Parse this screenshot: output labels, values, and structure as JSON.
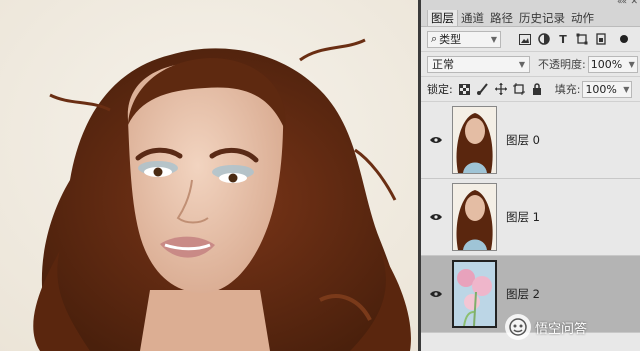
{
  "canvas": {
    "description_icon": "portrait-photo"
  },
  "panel": {
    "collapse_glyph": "««",
    "menu_glyph": "✕",
    "tabs": [
      {
        "label": "图层",
        "active": true
      },
      {
        "label": "通道",
        "active": false
      },
      {
        "label": "路径",
        "active": false
      },
      {
        "label": "历史记录",
        "active": false
      },
      {
        "label": "动作",
        "active": false
      }
    ],
    "filter": {
      "search_glyph": "⌕",
      "value": "类型"
    },
    "filter_icons": [
      "image-filter-icon",
      "adjustment-filter-icon",
      "text-filter-icon",
      "shape-filter-icon",
      "smart-object-filter-icon"
    ],
    "blend_mode": "正常",
    "opacity_label": "不透明度:",
    "opacity_value": "100%",
    "lock_label": "锁定:",
    "lock_icons": [
      "lock-transparent-icon",
      "lock-image-icon",
      "lock-position-icon",
      "lock-artboard-icon",
      "lock-all-icon"
    ],
    "fill_label": "填充:",
    "fill_value": "100%",
    "layers": [
      {
        "name": "图层 0",
        "selected": false,
        "thumb": "portrait"
      },
      {
        "name": "图层 1",
        "selected": false,
        "thumb": "portrait"
      },
      {
        "name": "图层 2",
        "selected": true,
        "thumb": "flowers"
      }
    ]
  },
  "watermark": {
    "text": "悟空问答"
  },
  "colors": {
    "panel_bg": "#e8e8e8",
    "selected_layer": "#b4b4b4",
    "canvas_bg": "#f1ece2",
    "hair": "#6b2f14",
    "skin": "#e9c6ad"
  }
}
